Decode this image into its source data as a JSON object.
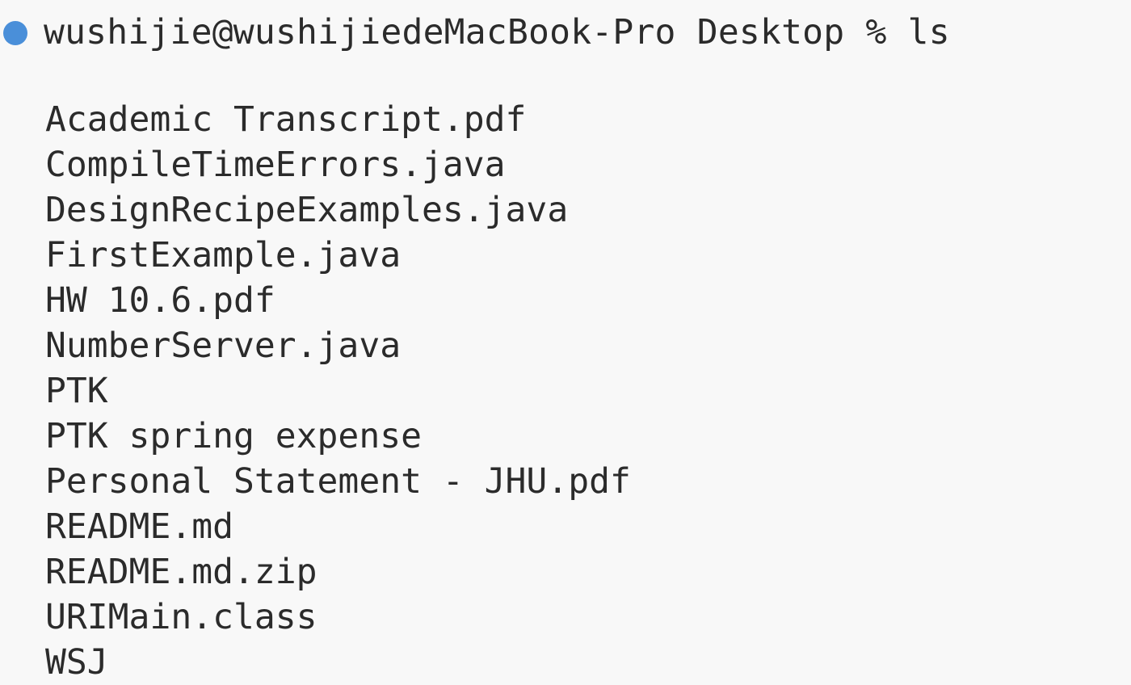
{
  "terminal": {
    "prompt": "wushijie@wushijiedeMacBook-Pro Desktop % ls",
    "status_color": "#4a8fd9",
    "files": [
      "Academic Transcript.pdf",
      "CompileTimeErrors.java",
      "DesignRecipeExamples.java",
      "FirstExample.java",
      "HW 10.6.pdf",
      "NumberServer.java",
      "PTK",
      "PTK spring expense",
      "Personal Statement - JHU.pdf",
      "README.md",
      "README.md.zip",
      "URIMain.class",
      "WSJ"
    ]
  }
}
